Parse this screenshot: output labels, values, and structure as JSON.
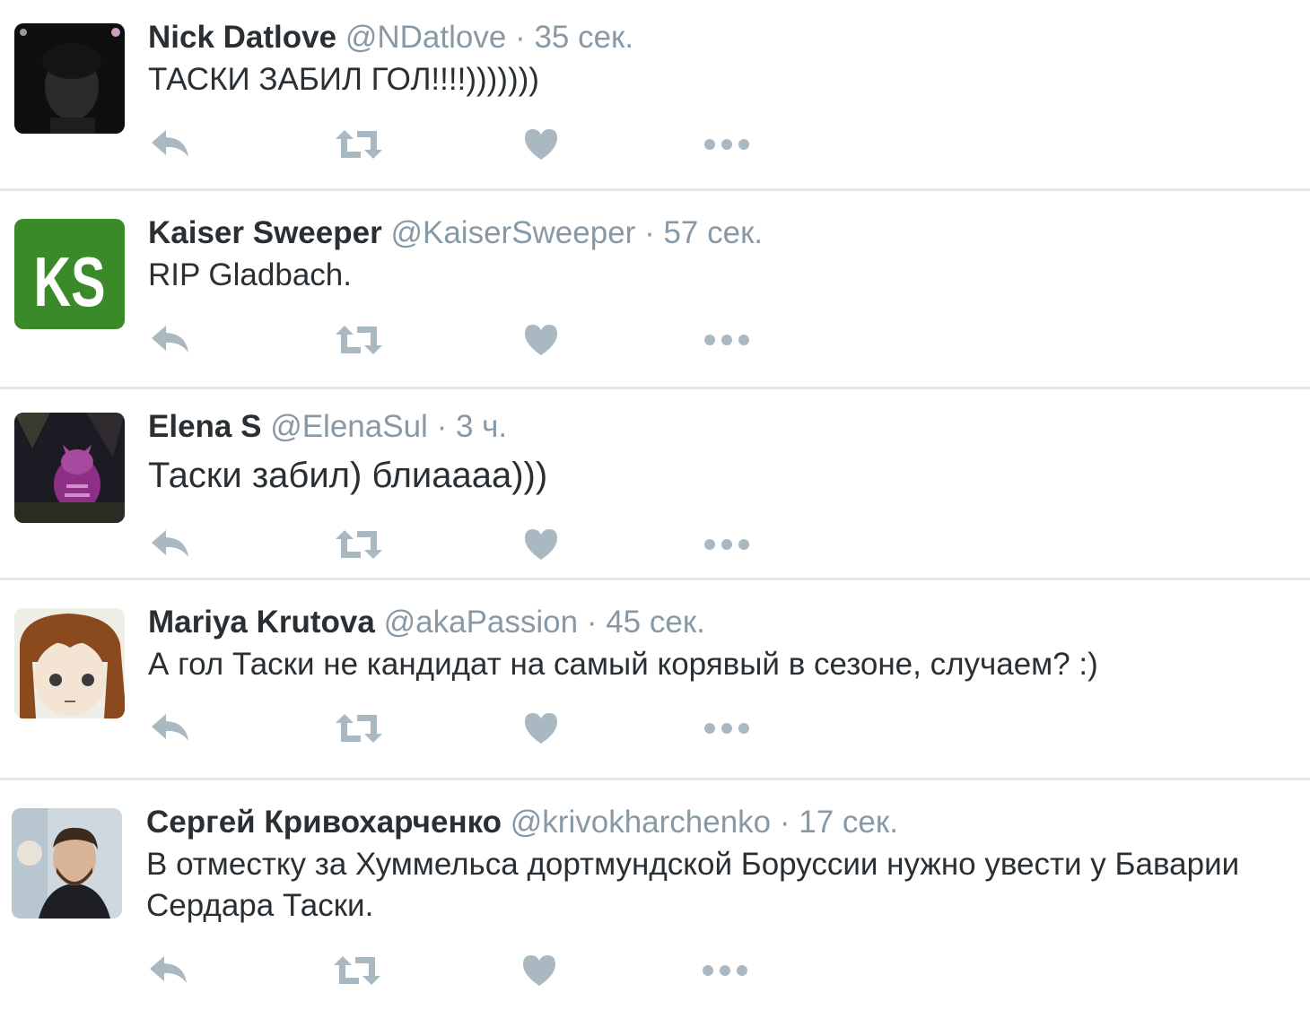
{
  "colors": {
    "text": "#292f33",
    "secondary": "#8899a6",
    "icon": "#aab8c2",
    "divider": "#e1e8ed",
    "ks_green": "#3b8a2a"
  },
  "icons": [
    "reply-icon",
    "retweet-icon",
    "like-heart-icon",
    "more-dots-icon"
  ],
  "tweets": [
    {
      "fullname": "Nick Datlove",
      "username": "@NDatlove",
      "sep": "·",
      "time": "35 сек.",
      "text": "ТАСКИ ЗАБИЛ ГОЛ!!!!)))))))"
    },
    {
      "fullname": "Kaiser Sweeper",
      "username": "@KaiserSweeper",
      "sep": "·",
      "time": "57 сек.",
      "text": "RIP Gladbach.",
      "avatar_text": "KS"
    },
    {
      "fullname": "Elena S",
      "username": "@ElenaSul",
      "sep": "·",
      "time": "3 ч.",
      "text": "Таски забил) блиаааа)))"
    },
    {
      "fullname": "Mariya Krutova",
      "username": "@akaPassion",
      "sep": "·",
      "time": "45 сек.",
      "text": "А гол Таски не кандидат на самый корявый в сезоне, случаем? :)"
    },
    {
      "fullname": "Сергей Кривохарченко",
      "username": "@krivokharchenko",
      "sep": "·",
      "time": "17 сек.",
      "text": "В отместку за Хуммельса дортмундской Боруссии нужно увести у Баварии Сердара Таски."
    }
  ]
}
